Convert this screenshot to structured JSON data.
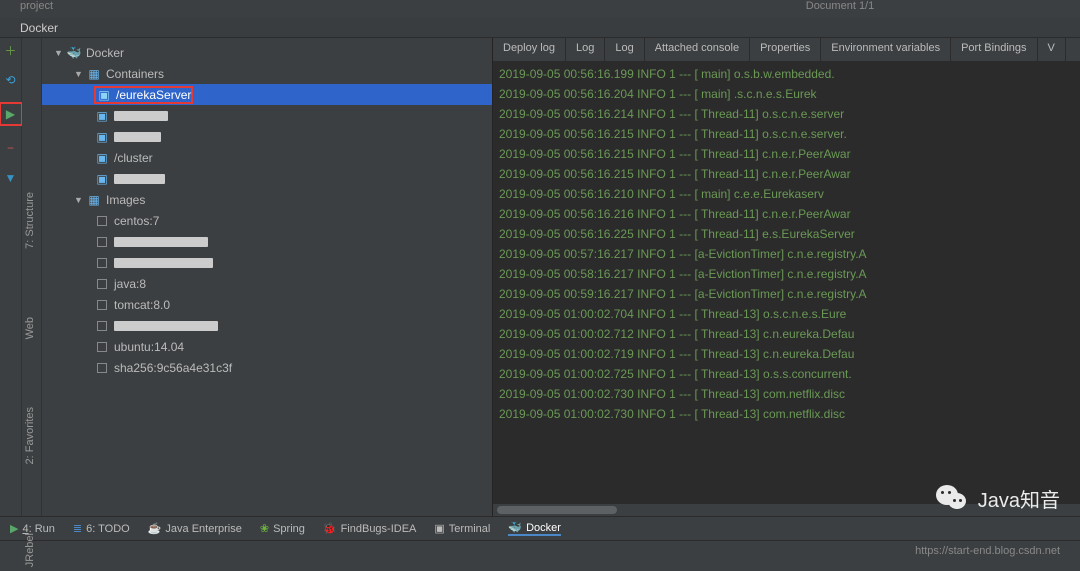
{
  "top": {
    "project": "project",
    "doc": "Document 1/1"
  },
  "panel_title": "Docker",
  "tree": {
    "root": "Docker",
    "containers": "Containers",
    "images": "Images",
    "selected": "/eurekaServer",
    "container_items": [
      "redacted-3",
      "redacted",
      "/cluster",
      "redacted"
    ],
    "image_items": [
      "centos:7",
      "redacted",
      "redacted",
      "java:8",
      "tomcat:8.0",
      "redacted-st",
      "ubuntu:14.04",
      "sha256:9c56a4e31c3f"
    ]
  },
  "log_tabs": [
    "Deploy log",
    "Log",
    "Log",
    "Attached console",
    "Properties",
    "Environment variables",
    "Port Bindings",
    "V"
  ],
  "log_lines": [
    {
      "ts": "2019-09-05 00:56:16.199",
      "lvl": "INFO 1 --- [",
      "th": "main]",
      "cls": "o.s.b.w.embedded."
    },
    {
      "ts": "2019-09-05 00:56:16.204",
      "lvl": "INFO 1 --- [",
      "th": "main]",
      "cls": ".s.c.n.e.s.Eurek"
    },
    {
      "ts": "2019-09-05 00:56:16.214",
      "lvl": "INFO 1 --- [",
      "th": "Thread-11]",
      "cls": "o.s.c.n.e.server"
    },
    {
      "ts": "2019-09-05 00:56:16.215",
      "lvl": "INFO 1 --- [",
      "th": "Thread-11]",
      "cls": "o.s.c.n.e.server."
    },
    {
      "ts": "2019-09-05 00:56:16.215",
      "lvl": "INFO 1 --- [",
      "th": "Thread-11]",
      "cls": "c.n.e.r.PeerAwar"
    },
    {
      "ts": "2019-09-05 00:56:16.215",
      "lvl": "INFO 1 --- [",
      "th": "Thread-11]",
      "cls": "c.n.e.r.PeerAwar"
    },
    {
      "ts": "2019-09-05 00:56:16.210",
      "lvl": "INFO 1 --- [",
      "th": "main]",
      "cls": "c.e.e.Eurekaserv"
    },
    {
      "ts": "2019-09-05 00:56:16.216",
      "lvl": "INFO 1 --- [",
      "th": "Thread-11]",
      "cls": "c.n.e.r.PeerAwar"
    },
    {
      "ts": "2019-09-05 00:56:16.225",
      "lvl": "INFO 1 --- [",
      "th": "Thread-11]",
      "cls": "e.s.EurekaServer"
    },
    {
      "ts": "2019-09-05 00:57:16.217",
      "lvl": "INFO 1 --- [",
      "th": "a-EvictionTimer]",
      "cls": "c.n.e.registry.A"
    },
    {
      "ts": "2019-09-05 00:58:16.217",
      "lvl": "INFO 1 --- [",
      "th": "a-EvictionTimer]",
      "cls": "c.n.e.registry.A"
    },
    {
      "ts": "2019-09-05 00:59:16.217",
      "lvl": "INFO 1 --- [",
      "th": "a-EvictionTimer]",
      "cls": "c.n.e.registry.A"
    },
    {
      "ts": "2019-09-05 01:00:02.704",
      "lvl": "INFO 1 --- [",
      "th": "Thread-13]",
      "cls": "o.s.c.n.e.s.Eure"
    },
    {
      "ts": "2019-09-05 01:00:02.712",
      "lvl": "INFO 1 --- [",
      "th": "Thread-13]",
      "cls": "c.n.eureka.Defau"
    },
    {
      "ts": "2019-09-05 01:00:02.719",
      "lvl": "INFO 1 --- [",
      "th": "Thread-13]",
      "cls": "c.n.eureka.Defau"
    },
    {
      "ts": "2019-09-05 01:00:02.725",
      "lvl": "INFO 1 --- [",
      "th": "Thread-13]",
      "cls": "o.s.s.concurrent."
    },
    {
      "ts": "2019-09-05 01:00:02.730",
      "lvl": "INFO 1 --- [",
      "th": "Thread-13]",
      "cls": "com.netflix.disc"
    },
    {
      "ts": "2019-09-05 01:00:02.730",
      "lvl": "INFO 1 --- [",
      "th": "Thread-13]",
      "cls": "com.netflix.disc"
    }
  ],
  "bottom": {
    "run": "4: Run",
    "todo": "6: TODO",
    "java_ent": "Java Enterprise",
    "spring": "Spring",
    "findbugs": "FindBugs-IDEA",
    "terminal": "Terminal",
    "docker": "Docker"
  },
  "status_url": "https://start-end.blog.csdn.net",
  "watermark": "Java知音",
  "vtabs": {
    "structure": "7: Structure",
    "web": "Web",
    "favorites": "2: Favorites",
    "jrebel": "JRebel"
  }
}
